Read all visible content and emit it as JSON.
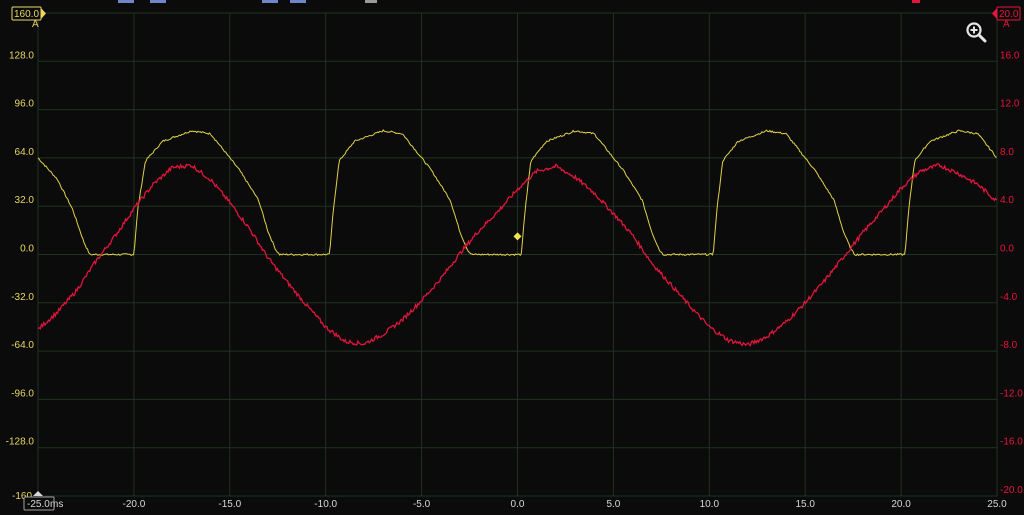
{
  "colors": {
    "background": "#0b0b0b",
    "grid": "#1f3322",
    "channel_a": "#e0d24a",
    "channel_b": "#e0163c",
    "axis_text_left": "#e8d860",
    "axis_text_right": "#e8163c",
    "time_text": "#d8d8d8"
  },
  "scales": {
    "left_top_badge": "160.0",
    "left_unit": "A",
    "right_top_badge": "20.0",
    "right_unit": "A",
    "time_start_badge": "-25.0",
    "time_unit": "ms",
    "left_bottom_label": "-160"
  },
  "icons": {
    "zoom": "zoom-in-icon"
  },
  "chart_data": {
    "type": "line",
    "x_range": [
      -25,
      25
    ],
    "x_ticks": [
      "-20.0",
      "-15.0",
      "-10.0",
      "-5.0",
      "0.0",
      "5.0",
      "10.0",
      "15.0",
      "20.0",
      "25.0"
    ],
    "x_tick_values": [
      -20,
      -15,
      -10,
      -5,
      0,
      5,
      10,
      15,
      20,
      25
    ],
    "y_left_range": [
      -160,
      160
    ],
    "y_left_ticks": [
      "128.0",
      "96.0",
      "64.0",
      "32.0",
      "0.0",
      "-32.0",
      "-64.0",
      "-96.0",
      "-128.0"
    ],
    "y_left_tick_values": [
      128,
      96,
      64,
      32,
      0,
      -32,
      -64,
      -96,
      -128
    ],
    "y_right_range": [
      -20,
      20
    ],
    "y_right_ticks": [
      "16.0",
      "12.0",
      "8.0",
      "4.0",
      "0.0",
      "-4.0",
      "-8.0",
      "-12.0",
      "-16.0",
      "-20.0"
    ],
    "y_right_tick_values": [
      16,
      12,
      8,
      4,
      0,
      -4,
      -8,
      -12,
      -16,
      -20
    ],
    "grid": true,
    "trigger": {
      "x": 0,
      "y": 12
    },
    "series": [
      {
        "axis": "left",
        "color": "#e0d24a",
        "x": [
          -25,
          -24,
          -23.2,
          -22.6,
          -22.3,
          -21.5,
          -20.5,
          -20.0,
          -19.8,
          -19.4,
          -18.5,
          -17.0,
          -16.0,
          -15.5,
          -14.5,
          -13.5,
          -13.0,
          -12.6,
          -12.4,
          -11.5,
          -10.5,
          -9.8,
          -9.6,
          -9.3,
          -8.5,
          -7.0,
          -6.0,
          -5.5,
          -4.5,
          -3.5,
          -3.0,
          -2.6,
          -2.4,
          -1.5,
          -0.5,
          0.2,
          0.4,
          0.7,
          1.5,
          3.0,
          4.0,
          4.5,
          5.5,
          6.5,
          7.0,
          7.4,
          7.6,
          8.5,
          9.5,
          10.2,
          10.4,
          10.7,
          11.5,
          13.0,
          14.0,
          14.5,
          15.5,
          16.5,
          17.0,
          17.4,
          17.6,
          18.5,
          19.5,
          20.2,
          20.4,
          20.7,
          21.5,
          23.0,
          24.0,
          24.5,
          25.0
        ],
        "y": [
          64,
          50,
          30,
          8,
          0,
          0,
          0,
          0,
          30,
          62,
          75,
          82,
          80,
          72,
          56,
          36,
          15,
          3,
          0,
          0,
          0,
          0,
          30,
          62,
          75,
          82,
          80,
          72,
          56,
          36,
          15,
          3,
          0,
          0,
          0,
          0,
          30,
          62,
          75,
          82,
          80,
          72,
          56,
          36,
          15,
          3,
          0,
          0,
          0,
          0,
          30,
          62,
          75,
          82,
          80,
          72,
          56,
          36,
          15,
          3,
          0,
          0,
          0,
          0,
          30,
          62,
          75,
          82,
          80,
          72,
          64
        ]
      },
      {
        "axis": "right",
        "color": "#e0163c",
        "x": [
          -25,
          -24,
          -23,
          -22,
          -21,
          -20,
          -19,
          -18,
          -17,
          -16,
          -15,
          -14,
          -13,
          -12,
          -11,
          -10,
          -9,
          -8,
          -7,
          -6,
          -5,
          -4,
          -3,
          -2,
          -1,
          0,
          1,
          2,
          3,
          4,
          5,
          6,
          7,
          8,
          9,
          10,
          11,
          12,
          13,
          14,
          15,
          16,
          17,
          18,
          19,
          20,
          21,
          22,
          23,
          24,
          25
        ],
        "y": [
          -6.2,
          -4.8,
          -3.0,
          -0.6,
          1.5,
          3.8,
          5.8,
          7.2,
          7.4,
          6.2,
          4.3,
          2.2,
          -0.3,
          -2.3,
          -4.2,
          -6.0,
          -7.2,
          -7.4,
          -6.6,
          -5.4,
          -3.8,
          -2.0,
          0.1,
          2.0,
          3.6,
          5.4,
          6.9,
          7.3,
          6.4,
          5.1,
          3.4,
          1.6,
          -0.7,
          -2.5,
          -4.3,
          -6.0,
          -7.1,
          -7.5,
          -6.8,
          -5.6,
          -4.0,
          -2.2,
          -0.2,
          1.8,
          3.6,
          5.5,
          6.9,
          7.4,
          6.7,
          5.8,
          4.4
        ]
      }
    ]
  }
}
